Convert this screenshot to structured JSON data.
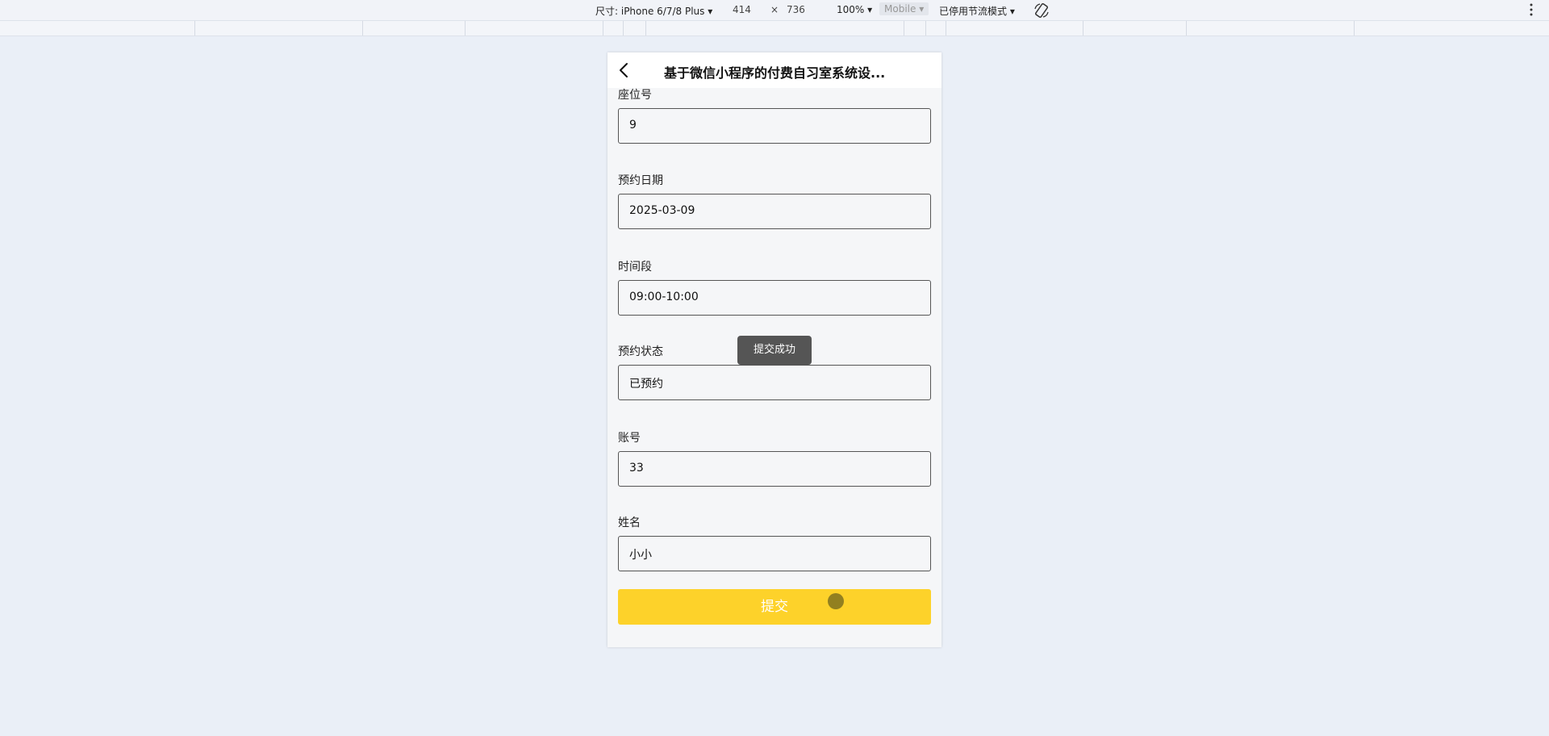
{
  "devtools": {
    "device_label": "尺寸: iPhone 6/7/8 Plus",
    "width": "414",
    "times": "×",
    "height": "736",
    "zoom": "100%",
    "mode": "Mobile",
    "throttle": "已停用节流模式"
  },
  "page": {
    "title": "基于微信小程序的付费自习室系统设...",
    "fields": [
      {
        "label": "座位号",
        "value": "9"
      },
      {
        "label": "预约日期",
        "value": "2025-03-09"
      },
      {
        "label": "时间段",
        "value": "09:00-10:00"
      },
      {
        "label": "预约状态",
        "value": "已预约"
      },
      {
        "label": "账号",
        "value": "33"
      },
      {
        "label": "姓名",
        "value": "小小"
      }
    ],
    "submit_label": "提交",
    "toast": "提交成功"
  },
  "colors": {
    "accent": "#fdd22a",
    "background": "#eaeff7",
    "toast": "#555555"
  }
}
